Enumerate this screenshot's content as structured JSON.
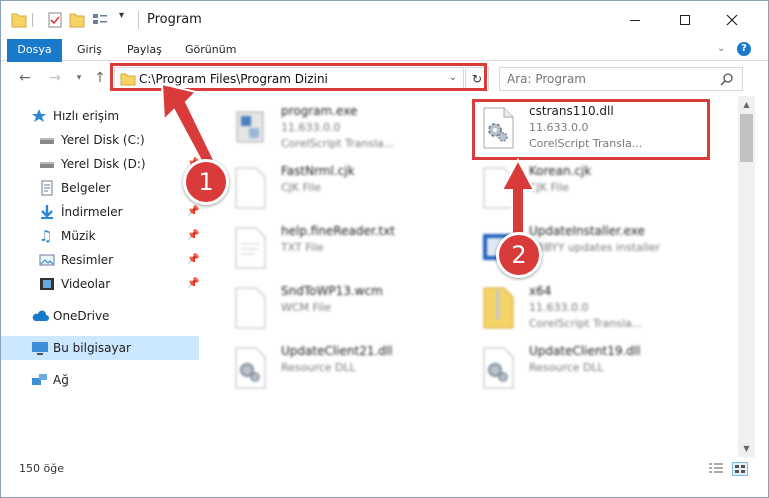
{
  "window": {
    "title": "Program"
  },
  "ribbon": {
    "tabs": [
      "Dosya",
      "Giriş",
      "Paylaş",
      "Görünüm"
    ]
  },
  "address": {
    "path": "C:\\Program Files\\Program Dizini"
  },
  "search": {
    "placeholder": "Ara: Program"
  },
  "sidebar": {
    "items": [
      {
        "label": "Hızlı erişim",
        "icon": "star-icon",
        "pinned": false
      },
      {
        "label": "Yerel Disk (C:)",
        "icon": "drive-icon",
        "pinned": false
      },
      {
        "label": "Yerel Disk (D:)",
        "icon": "drive-icon",
        "pinned": true
      },
      {
        "label": "Belgeler",
        "icon": "documents-icon",
        "pinned": true
      },
      {
        "label": "İndirmeler",
        "icon": "download-icon",
        "pinned": true
      },
      {
        "label": "Müzik",
        "icon": "music-icon",
        "pinned": true
      },
      {
        "label": "Resimler",
        "icon": "pictures-icon",
        "pinned": true
      },
      {
        "label": "Videolar",
        "icon": "video-icon",
        "pinned": true
      },
      {
        "label": "OneDrive",
        "icon": "cloud-icon",
        "pinned": false
      },
      {
        "label": "Bu bilgisayar",
        "icon": "computer-icon",
        "pinned": false,
        "selected": true
      },
      {
        "label": "Ağ",
        "icon": "network-icon",
        "pinned": false
      }
    ]
  },
  "files": [
    {
      "name": "program.exe",
      "line2": "11.633.0.0",
      "line3": "CorelScript Transla...",
      "icon": "exe-icon"
    },
    {
      "name": "cstrans110.dll",
      "line2": "11.633.0.0",
      "line3": "CorelScript Transla...",
      "icon": "dll-gear-icon"
    },
    {
      "name": "FastNrml.cjk",
      "line2": "CJK File",
      "line3": "",
      "icon": "blank-file-icon"
    },
    {
      "name": "Korean.cjk",
      "line2": "CJK File",
      "line3": "",
      "icon": "blank-file-icon"
    },
    {
      "name": "help.fineReader.txt",
      "line2": "TXT File",
      "line3": "",
      "icon": "text-file-icon"
    },
    {
      "name": "UpdateInstaller.exe",
      "line2": "ABBYY updates installer",
      "line3": "",
      "icon": "installer-icon"
    },
    {
      "name": "SndToWP13.wcm",
      "line2": "WCM File",
      "line3": "",
      "icon": "blank-file-icon"
    },
    {
      "name": "x64",
      "line2": "11.633.0.0",
      "line3": "CorelScript Transla...",
      "icon": "zip-folder-icon"
    },
    {
      "name": "UpdateClient21.dll",
      "line2": "Resource DLL",
      "line3": "",
      "icon": "dll-gear-icon"
    },
    {
      "name": "UpdateClient19.dll",
      "line2": "Resource DLL",
      "line3": "",
      "icon": "dll-gear-icon"
    }
  ],
  "status": {
    "item_count": "150 öğe"
  },
  "annotations": {
    "step1": "1",
    "step2": "2",
    "highlight_color": "#d93b3b"
  },
  "colors": {
    "accent": "#1979ca",
    "selected_bg": "#cce8ff"
  }
}
